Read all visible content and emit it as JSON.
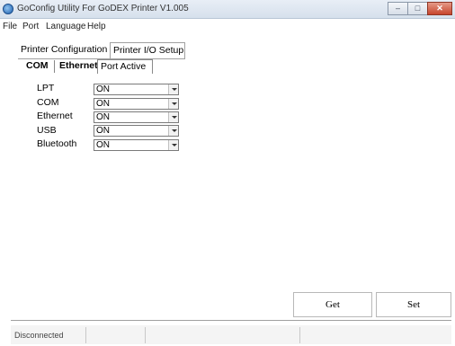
{
  "window": {
    "title": "GoConfig Utility For GoDEX Printer V1.005"
  },
  "menu": [
    "File",
    "Port",
    "Language",
    "Help"
  ],
  "main_tabs": [
    {
      "label": "Printer Configuration",
      "active": false
    },
    {
      "label": "Printer I/O Setup",
      "active": true
    }
  ],
  "sub_tabs": [
    {
      "label": "COM",
      "active": false
    },
    {
      "label": "Ethernet",
      "active": false
    },
    {
      "label": "Port Active",
      "active": true
    }
  ],
  "ports": [
    {
      "label": "LPT",
      "value": "ON"
    },
    {
      "label": "COM",
      "value": "ON"
    },
    {
      "label": "Ethernet",
      "value": "ON"
    },
    {
      "label": "USB",
      "value": "ON"
    },
    {
      "label": "Bluetooth",
      "value": "ON"
    }
  ],
  "buttons": {
    "get": "Get",
    "set": "Set"
  },
  "status": {
    "connection": "Disconnected",
    "cell2": "",
    "cell3": "",
    "cell4": ""
  }
}
